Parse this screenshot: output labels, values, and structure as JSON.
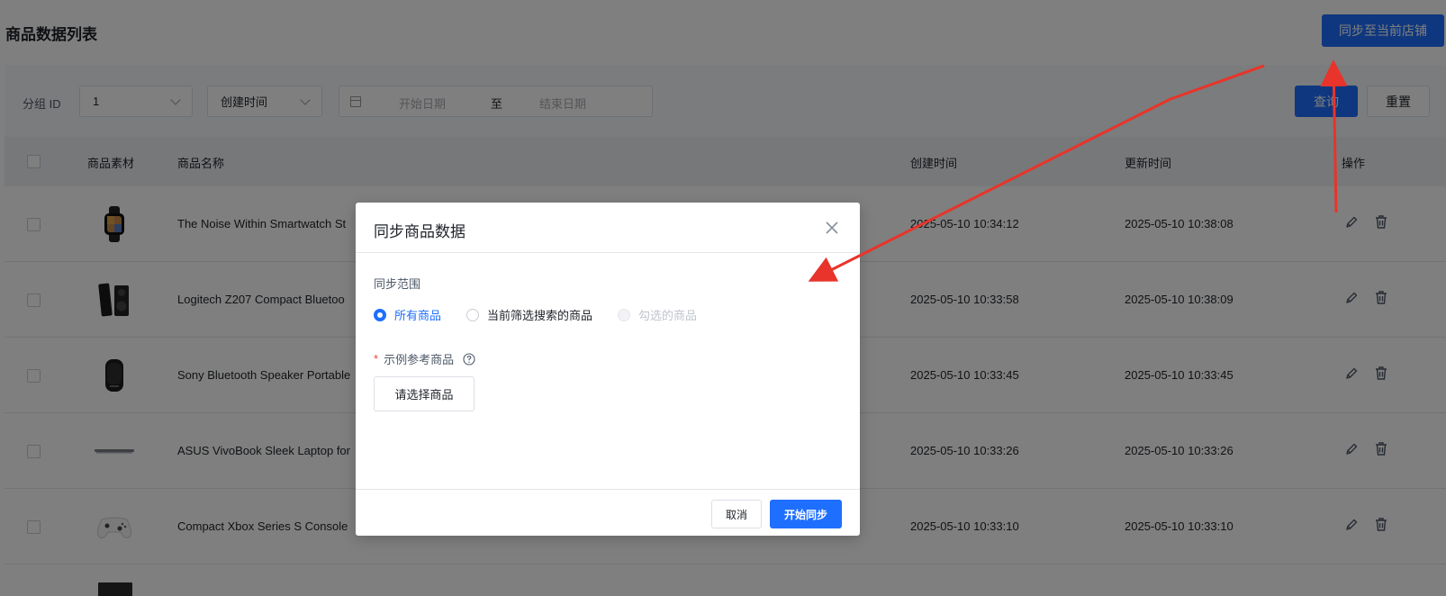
{
  "header": {
    "title": "商品数据列表",
    "sync_store_label": "同步至当前店铺"
  },
  "filters": {
    "group_id_label": "分组 ID",
    "group_id_value": "1",
    "time_field_value": "创建时间",
    "start_date_placeholder": "开始日期",
    "range_separator": "至",
    "end_date_placeholder": "结束日期",
    "query_label": "查询",
    "reset_label": "重置"
  },
  "table": {
    "columns": {
      "material": "商品素材",
      "name": "商品名称",
      "created": "创建时间",
      "updated": "更新时间",
      "actions": "操作"
    },
    "rows": [
      {
        "name": "The Noise Within Smartwatch St",
        "created": "2025-05-10 10:34:12",
        "updated": "2025-05-10 10:38:08",
        "thumb": "smartwatch"
      },
      {
        "name": "Logitech Z207 Compact Bluetoo",
        "created": "2025-05-10 10:33:58",
        "updated": "2025-05-10 10:38:09",
        "thumb": "speakers"
      },
      {
        "name": "Sony Bluetooth Speaker Portable",
        "created": "2025-05-10 10:33:45",
        "updated": "2025-05-10 10:33:45",
        "thumb": "bluetooth-speaker"
      },
      {
        "name": "ASUS VivoBook Sleek Laptop for",
        "created": "2025-05-10 10:33:26",
        "updated": "2025-05-10 10:33:26",
        "thumb": "laptop"
      },
      {
        "name": "Compact Xbox Series S Console",
        "created": "2025-05-10 10:33:10",
        "updated": "2025-05-10 10:33:10",
        "thumb": "game-controller"
      }
    ]
  },
  "modal": {
    "title": "同步商品数据",
    "scope_label": "同步范围",
    "options": [
      {
        "label": "所有商品",
        "state": "checked"
      },
      {
        "label": "当前筛选搜索的商品",
        "state": "unchecked"
      },
      {
        "label": "勾选的商品",
        "state": "disabled"
      }
    ],
    "required_mark": "*",
    "sample_label": "示例参考商品",
    "select_product_label": "请选择商品",
    "cancel_label": "取消",
    "start_label": "开始同步"
  },
  "colors": {
    "primary": "#1f6fff",
    "annotation": "#e8342a"
  }
}
